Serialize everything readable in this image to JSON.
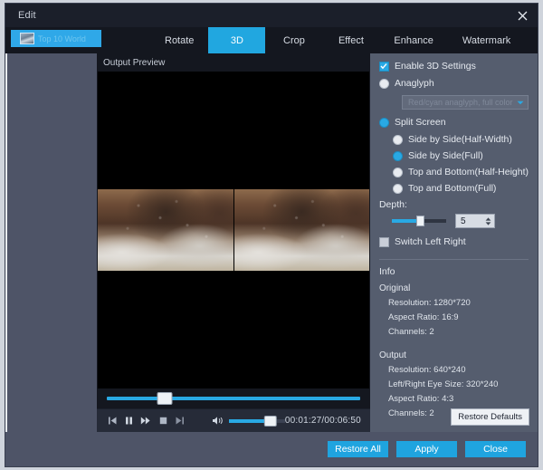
{
  "window": {
    "title": "Edit",
    "close_icon": "close-icon"
  },
  "sidebar": {
    "item_label": "Top 10 World"
  },
  "tabs": [
    {
      "label": "Rotate",
      "active": false
    },
    {
      "label": "3D",
      "active": true
    },
    {
      "label": "Crop",
      "active": false
    },
    {
      "label": "Effect",
      "active": false
    },
    {
      "label": "Enhance",
      "active": false
    },
    {
      "label": "Watermark",
      "active": false
    }
  ],
  "preview": {
    "label": "Output Preview",
    "seek_percent": 23,
    "transport": [
      {
        "name": "previous-frame-button",
        "icon": "skip-back-icon"
      },
      {
        "name": "pause-button",
        "icon": "pause-icon"
      },
      {
        "name": "fast-forward-button",
        "icon": "fast-forward-icon"
      },
      {
        "name": "stop-button",
        "icon": "stop-icon"
      },
      {
        "name": "next-frame-button",
        "icon": "skip-forward-icon"
      }
    ],
    "volume_icon": "speaker-icon",
    "volume_percent": 70,
    "timecode": "00:01:27/00:06:50"
  },
  "settings": {
    "enable_3d": {
      "label": "Enable 3D Settings",
      "checked": true
    },
    "anaglyph": {
      "label": "Anaglyph",
      "selected": false
    },
    "anaglyph_mode": {
      "value": "Red/cyan anaglyph, full color",
      "disabled": true,
      "caret_icon": "chevron-down-icon"
    },
    "split_screen": {
      "label": "Split Screen",
      "selected": true
    },
    "split_options": [
      {
        "label": "Side by Side(Half-Width)",
        "selected": false
      },
      {
        "label": "Side by Side(Full)",
        "selected": true
      },
      {
        "label": "Top and Bottom(Half-Height)",
        "selected": false
      },
      {
        "label": "Top and Bottom(Full)",
        "selected": false
      }
    ],
    "depth": {
      "label": "Depth:",
      "value": "5",
      "percent": 45
    },
    "switch_left_right": {
      "label": "Switch Left Right",
      "checked": false
    }
  },
  "info": {
    "title": "Info",
    "original": {
      "heading": "Original",
      "lines": [
        "Resolution: 1280*720",
        "Aspect Ratio: 16:9",
        "Channels: 2"
      ]
    },
    "output": {
      "heading": "Output",
      "lines": [
        "Resolution: 640*240",
        "Left/Right Eye Size: 320*240",
        "Aspect Ratio: 4:3",
        "Channels: 2"
      ]
    },
    "restore_defaults_label": "Restore Defaults"
  },
  "footer": {
    "restore_all_label": "Restore All",
    "apply_label": "Apply",
    "close_label": "Close"
  },
  "colors": {
    "accent": "#29a9e4",
    "panel": "#555d6e",
    "sidebar": "#4e5467",
    "dark": "#14171f"
  }
}
